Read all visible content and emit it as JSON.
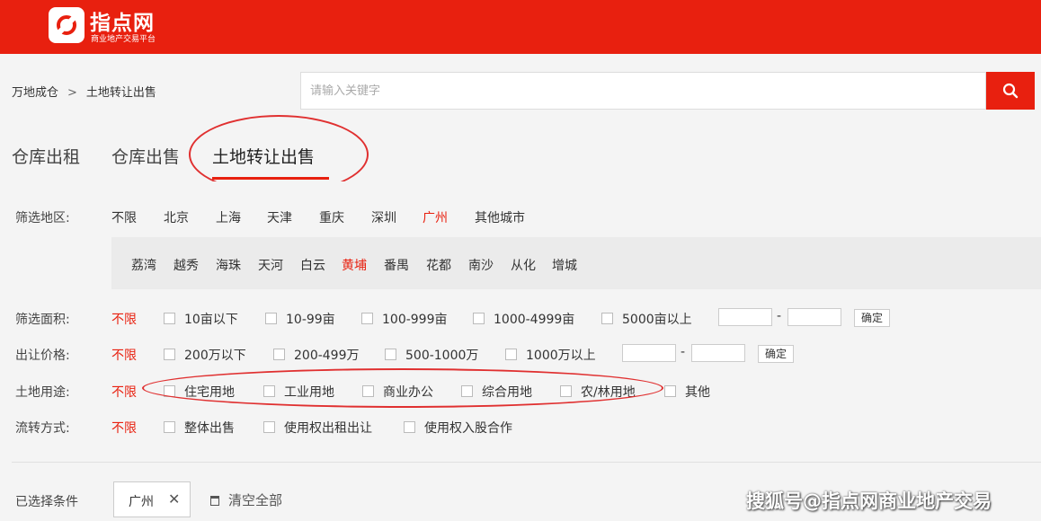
{
  "brand": {
    "name": "指点网",
    "slogan": "商业地产交易平台"
  },
  "breadcrumb": {
    "home": "万地成仓",
    "separator": ">",
    "current": "土地转让出售"
  },
  "search": {
    "placeholder": "请输入关键字",
    "icon": "search-icon"
  },
  "tabs": [
    {
      "label": "仓库出租",
      "active": false
    },
    {
      "label": "仓库出售",
      "active": false
    },
    {
      "label": "土地转让出售",
      "active": true
    }
  ],
  "filters": {
    "region": {
      "label": "筛选地区:",
      "options": [
        "不限",
        "北京",
        "上海",
        "天津",
        "重庆",
        "深圳",
        "广州",
        "其他城市"
      ],
      "selected": "广州",
      "districts": [
        "荔湾",
        "越秀",
        "海珠",
        "天河",
        "白云",
        "黄埔",
        "番禺",
        "花都",
        "南沙",
        "从化",
        "增城"
      ],
      "selected_district": "黄埔"
    },
    "area": {
      "label": "筛选面积:",
      "any": "不限",
      "options": [
        "10亩以下",
        "10-99亩",
        "100-999亩",
        "1000-4999亩",
        "5000亩以上"
      ],
      "range_separator": "-",
      "confirm": "确定"
    },
    "price": {
      "label": "出让价格:",
      "any": "不限",
      "options": [
        "200万以下",
        "200-499万",
        "500-1000万",
        "1000万以上"
      ],
      "range_separator": "-",
      "confirm": "确定"
    },
    "land_use": {
      "label": "土地用途:",
      "any": "不限",
      "options": [
        "住宅用地",
        "工业用地",
        "商业办公",
        "综合用地",
        "农/林用地",
        "其他"
      ]
    },
    "transfer": {
      "label": "流转方式:",
      "any": "不限",
      "options": [
        "整体出售",
        "使用权出租出让",
        "使用权入股合作"
      ]
    }
  },
  "selected": {
    "label": "已选择条件",
    "tags": [
      "广州"
    ],
    "close_glyph": "✕",
    "clear_all": "清空全部"
  },
  "watermark": "搜狐号@指点网商业地产交易",
  "colors": {
    "brand_red": "#e8200f",
    "annotation_red": "#e03030"
  }
}
